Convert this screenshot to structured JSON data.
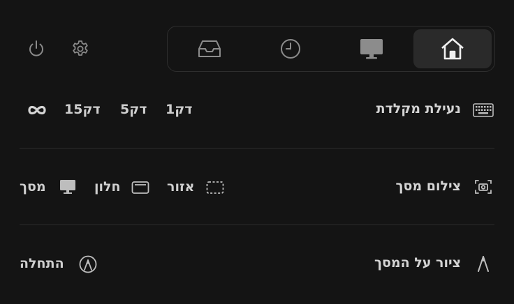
{
  "toolbar": {
    "power_icon": "power-icon",
    "settings_icon": "gear-icon",
    "tabs": [
      {
        "name": "home",
        "icon": "home-icon",
        "active": true
      },
      {
        "name": "display",
        "icon": "monitor-icon",
        "active": false
      },
      {
        "name": "history",
        "icon": "clock-icon",
        "active": false
      },
      {
        "name": "inbox",
        "icon": "inbox-tray-icon",
        "active": false
      }
    ]
  },
  "keyboard_lock": {
    "label": "נעילת מקלדת",
    "icon": "keyboard-icon",
    "options": [
      "1דק",
      "5דק",
      "15דק"
    ],
    "infinite_icon": "infinity-icon"
  },
  "screenshot": {
    "label": "צילום מסך",
    "icon": "camera-icon",
    "options": [
      {
        "label": "אזור",
        "icon": "dashed-region-icon"
      },
      {
        "label": "חלון",
        "icon": "window-icon"
      },
      {
        "label": "מסך",
        "icon": "monitor-icon"
      }
    ]
  },
  "draw": {
    "label": "ציור על המסך",
    "icon": "pen-nib-icon",
    "start_label": "התחלה",
    "start_icon": "pen-circle-icon"
  },
  "colors": {
    "background": "#141414",
    "text": "#d4d4d4",
    "divider": "#2c2c2c",
    "active_tab": "#2a2a2a"
  }
}
